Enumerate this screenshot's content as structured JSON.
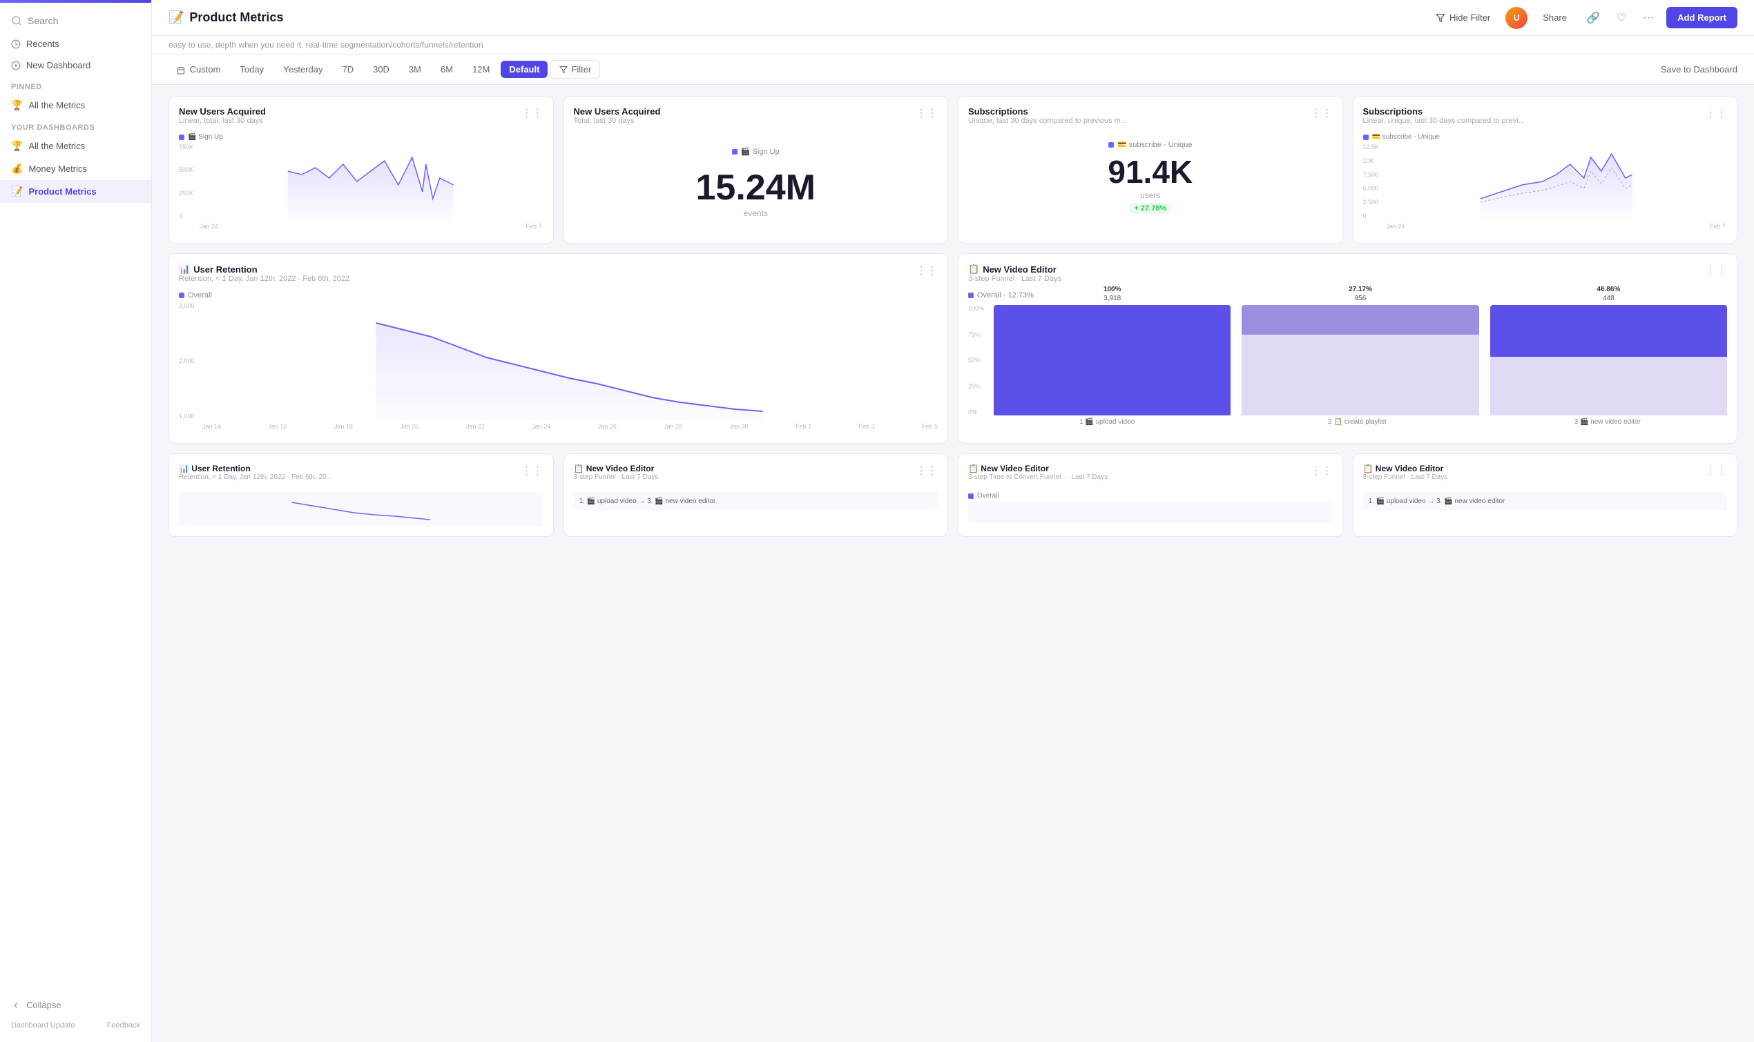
{
  "sidebar": {
    "search_label": "Search",
    "recents_label": "Recents",
    "new_dashboard_label": "New Dashboard",
    "pinned_label": "Pinned",
    "pinned_items": [
      {
        "label": "All the Metrics",
        "icon": "🏆",
        "active": false
      }
    ],
    "your_dashboards_label": "Your Dashboards",
    "dashboard_items": [
      {
        "label": "All the Metrics",
        "icon": "🏆",
        "active": false
      },
      {
        "label": "Money Metrics",
        "icon": "💰",
        "active": false
      },
      {
        "label": "Product Metrics",
        "icon": "📝",
        "active": true
      }
    ],
    "collapse_label": "Collapse",
    "footer_left": "Dashboard Update",
    "footer_right": "Feedback"
  },
  "header": {
    "title_icon": "📝",
    "title": "Product Metrics",
    "hide_filter_label": "Hide Filter",
    "share_label": "Share",
    "add_report_label": "Add Report"
  },
  "subtitle": "easy to use, depth when you need it, real-time segmentation/cohorts/funnels/retention",
  "filter_bar": {
    "tabs": [
      "Custom",
      "Today",
      "Yesterday",
      "7D",
      "30D",
      "3M",
      "6M",
      "12M",
      "Default"
    ],
    "active_tab": "Default",
    "filter_label": "Filter",
    "save_label": "Save to Dashboard"
  },
  "cards": {
    "top_row": [
      {
        "id": "new-users-1",
        "title": "New Users Acquired",
        "subtitle": "Linear, total, last 30 days",
        "type": "line",
        "legend": "Sign Up",
        "legend_color": "#6c63ff",
        "y_labels": [
          "750K",
          "500K",
          "250K",
          "0"
        ],
        "x_labels": [
          "Jan 24",
          "Feb 7"
        ]
      },
      {
        "id": "new-users-2",
        "title": "New Users Acquired",
        "subtitle": "Total, last 30 days",
        "type": "big-number",
        "legend": "Sign Up",
        "legend_color": "#6c63ff",
        "value": "15.24M",
        "unit": "events"
      },
      {
        "id": "subscriptions-1",
        "title": "Subscriptions",
        "subtitle": "Unique, last 30 days compared to previous m...",
        "type": "big-number",
        "legend": "subscribe - Unique",
        "legend_color": "#6c63ff",
        "value": "91.4K",
        "unit": "users",
        "badge": "+ 27.78%"
      },
      {
        "id": "subscriptions-2",
        "title": "Subscriptions",
        "subtitle": "Linear, unique, last 30 days compared to previ...",
        "type": "line",
        "legend": "subscribe - Unique",
        "legend_color": "#6c63ff",
        "y_labels": [
          "12.5K",
          "10K",
          "7,500",
          "5,000",
          "2,500",
          "0"
        ],
        "x_labels": [
          "Jan 24",
          "Feb 7"
        ]
      }
    ],
    "bottom_large": [
      {
        "id": "user-retention",
        "title": "User Retention",
        "subtitle": "Retention, < 1 Day, Jan 12th, 2022 - Feb 6th, 2022",
        "type": "line",
        "legend": "Overall",
        "legend_color": "#6c63ff",
        "y_labels": [
          "3,000",
          "2,000",
          "1,000"
        ],
        "x_labels": [
          "Jan 14",
          "Jan 16",
          "Jan 18",
          "Jan 20",
          "Jan 22",
          "Jan 24",
          "Jan 26",
          "Jan 28",
          "Jan 30",
          "Feb 1",
          "Feb 3",
          "Feb 5"
        ]
      },
      {
        "id": "new-video-editor",
        "title": "New Video Editor",
        "subtitle": "3-step Funnel · Last 7 Days",
        "type": "funnel",
        "legend": "Overall · 12.73%",
        "legend_color": "#6c63ff",
        "funnel_bars": [
          {
            "label": "100%",
            "value": "3,918",
            "step": "1 🎬 upload video",
            "color": "#5b50e8",
            "height_pct": 100
          },
          {
            "label": "27.17%",
            "value": "956",
            "step": "2 📋 create playlist",
            "color": "#9b8de0",
            "height_pct": 27
          },
          {
            "label": "46.86%",
            "value": "448",
            "step": "3 🎬 new video editor",
            "color": "#5b50e8",
            "height_pct": 47
          }
        ],
        "y_labels": [
          "100%",
          "75%",
          "50%",
          "25%",
          "0%"
        ]
      }
    ],
    "mini_row": [
      {
        "id": "user-retention-mini",
        "title": "User Retention",
        "subtitle": "Retention, < 1 Day, Jan 12th, 2022 - Feb 6th, 20...",
        "type": "mini"
      },
      {
        "id": "new-video-editor-mini-1",
        "title": "New Video Editor",
        "subtitle": "3-step Funnel · Last 7 Days",
        "type": "mini",
        "mini_text": "1. 🎬 upload video → 3. 🎬 new video editor"
      },
      {
        "id": "new-video-editor-mini-2",
        "title": "New Video Editor",
        "subtitle": "3-step Time to Convert Funnel · · Last 7 Days",
        "type": "mini",
        "has_legend": true,
        "mini_legend": "Overall"
      },
      {
        "id": "new-video-editor-mini-3",
        "title": "New Video Editor",
        "subtitle": "3-step Funnel · Last 7 Days",
        "type": "mini",
        "mini_text": "1. 🎬 upload video → 3. 🎬 new video editor"
      }
    ]
  }
}
